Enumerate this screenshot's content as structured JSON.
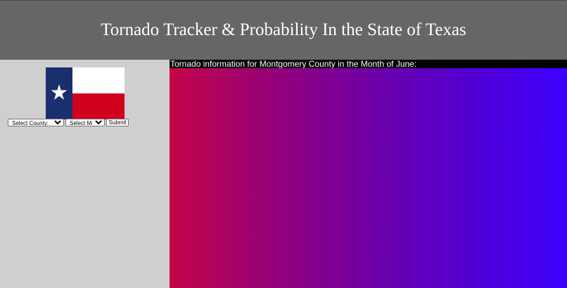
{
  "header": {
    "title": "Tornado Tracker & Probability In the State of Texas"
  },
  "sidebar": {
    "flag": {
      "icon": "texas-flag-icon",
      "colors": {
        "blue": "#1a2f6e",
        "white": "#ffffff",
        "red": "#d0021b",
        "star": "#ffffff"
      }
    },
    "county_select": {
      "selected": "Select County:"
    },
    "month_select": {
      "selected": "Select Month"
    },
    "submit_label": "Submit"
  },
  "main": {
    "info_text": "Tornado information for Montgomery County in the Month of June:",
    "gradient": {
      "start": "#c40548",
      "end": "#3c00ff"
    }
  }
}
